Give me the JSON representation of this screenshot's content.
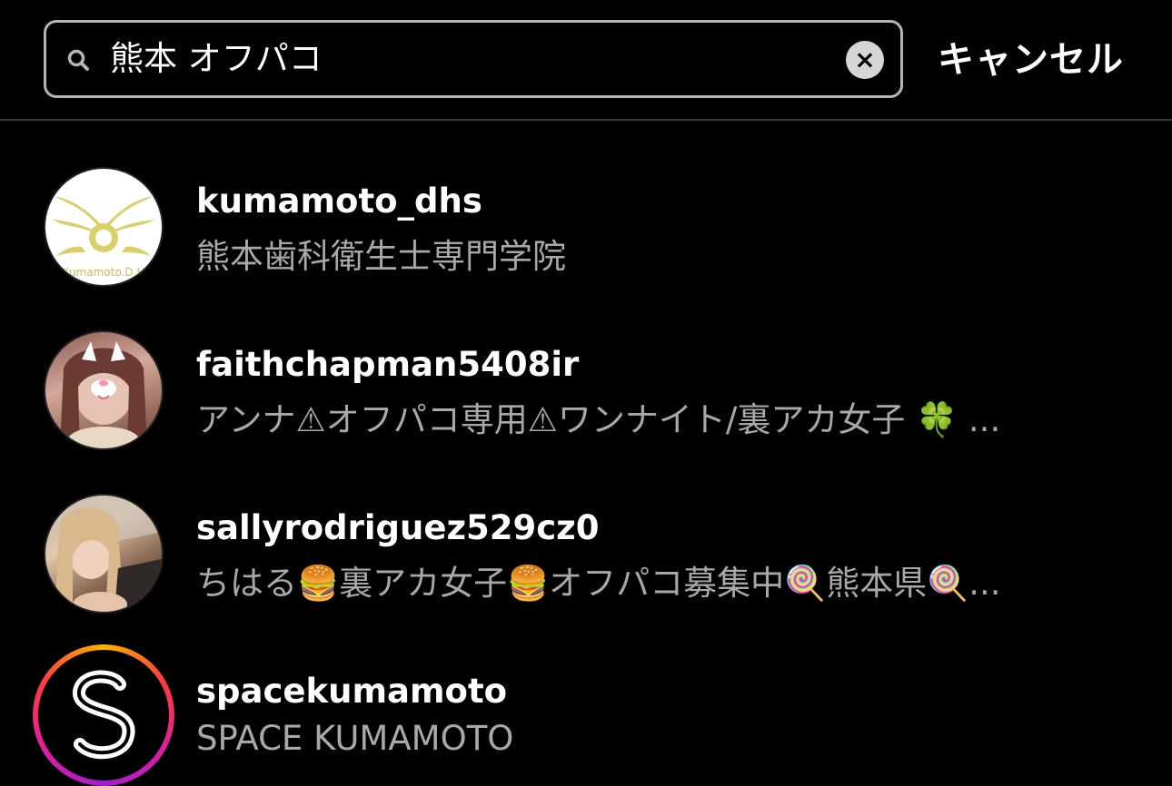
{
  "search": {
    "query": "熊本 オフパコ",
    "cancel_label": "キャンセル"
  },
  "results": [
    {
      "username": "kumamoto_dhs",
      "subtitle": "熊本歯科衛生士専門学院",
      "avatar_logo_text": "Kumamoto.D.H"
    },
    {
      "username": "faithchapman5408ir",
      "subtitle": "アンナ⚠オフパコ専用⚠ワンナイト/裏アカ女子 🍀 ..."
    },
    {
      "username": "sallyrodriguez529cz0",
      "subtitle": "ちはる🍔裏アカ女子🍔オフパコ募集中🍭熊本県🍭..."
    },
    {
      "username": "spacekumamoto",
      "subtitle": "SPACE KUMAMOTO"
    }
  ],
  "colors": {
    "background": "#000000",
    "primary_text": "#ffffff",
    "secondary_text": "#a8a8a8",
    "search_border": "#b5b5b5",
    "story_ring": [
      "#ffb300",
      "#ff3b3b",
      "#e01ca0",
      "#a21cd6"
    ]
  }
}
